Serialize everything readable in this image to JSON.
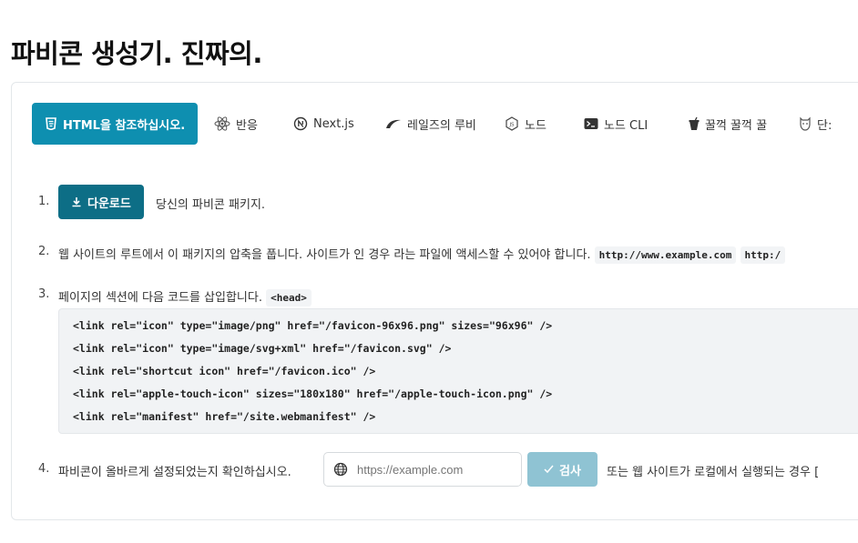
{
  "page": {
    "title": "파비콘 생성기. 진짜의."
  },
  "tabs": [
    {
      "label": "HTML을 참조하십시오.",
      "icon": "html5-icon",
      "active": true
    },
    {
      "label": "반응",
      "icon": "react-icon"
    },
    {
      "label": "Next.js",
      "icon": "nextjs-icon"
    },
    {
      "label": "레일즈의 루비",
      "icon": "rails-icon"
    },
    {
      "label": "노드",
      "icon": "nodejs-icon"
    },
    {
      "label": "노드 CLI",
      "icon": "terminal-icon"
    },
    {
      "label": "꿀꺽 꿀꺽 꿀",
      "icon": "gulp-icon"
    },
    {
      "label": "단:",
      "icon": "grunt-icon"
    }
  ],
  "steps": {
    "s1": {
      "num": "1.",
      "button": "다운로드",
      "text": "당신의 파비콘 패키지."
    },
    "s2": {
      "num": "2.",
      "text": "웹 사이트의 루트에서 이 패키지의 압축을 풉니다. 사이트가 인 경우 라는 파일에 액세스할 수 있어야 합니다.",
      "code1": "http://www.example.com",
      "code2": "http:/"
    },
    "s3": {
      "num": "3.",
      "text": "페이지의 섹션에 다음 코드를 삽입합니다.",
      "code": "<head>"
    },
    "s4": {
      "num": "4.",
      "text": "파비콘이 올바르게 설정되었는지 확인하십시오.",
      "placeholder": "https://example.com",
      "button": "검사",
      "after": "또는 웹 사이트가 로컬에서 실행되는 경우 ["
    }
  },
  "code_lines": [
    "<link rel=\"icon\" type=\"image/png\" href=\"/favicon-96x96.png\" sizes=\"96x96\" />",
    "<link rel=\"icon\" type=\"image/svg+xml\" href=\"/favicon.svg\" />",
    "<link rel=\"shortcut icon\" href=\"/favicon.ico\" />",
    "<link rel=\"apple-touch-icon\" sizes=\"180x180\" href=\"/apple-touch-icon.png\" />",
    "<link rel=\"manifest\" href=\"/site.webmanifest\" />"
  ],
  "colors": {
    "accent": "#0e8fb0",
    "download_button": "#0d6e86",
    "check_button": "#8fc3d3"
  }
}
